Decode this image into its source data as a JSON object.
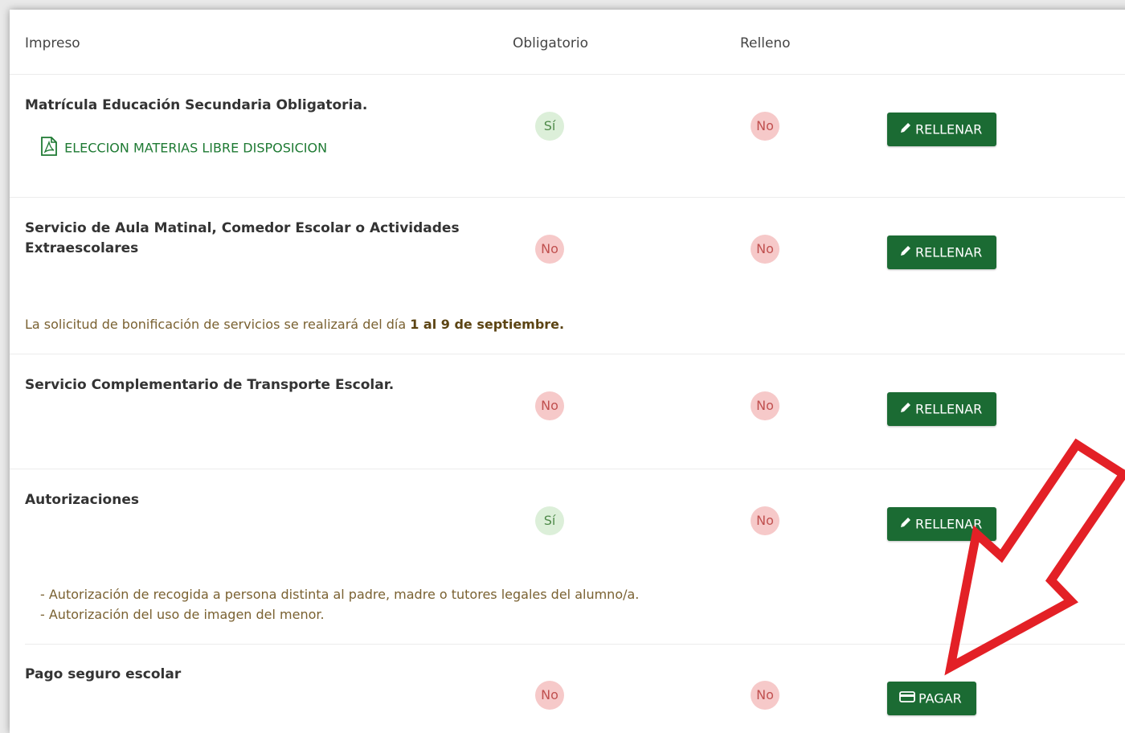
{
  "headers": {
    "impreso": "Impreso",
    "obligatorio": "Obligatorio",
    "relleno": "Relleno"
  },
  "rows": [
    {
      "title": "Matrícula Educación Secundaria Obligatoria.",
      "document_link": "ELECCION MATERIAS LIBRE DISPOSICION",
      "obligatorio": "Sí",
      "relleno": "No",
      "action": "RELLENAR",
      "action_icon": "pencil-icon"
    },
    {
      "title_line1": "Servicio de Aula Matinal, Comedor Escolar o Actividades",
      "title_line2": "Extraescolares",
      "obligatorio": "No",
      "relleno": "No",
      "action": "RELLENAR",
      "action_icon": "pencil-icon",
      "note_prefix": "La solicitud de bonificación de servicios se realizará del día ",
      "note_bold": "1 al 9 de septiembre."
    },
    {
      "title": "Servicio Complementario de Transporte Escolar.",
      "obligatorio": "No",
      "relleno": "No",
      "action": "RELLENAR",
      "action_icon": "pencil-icon"
    },
    {
      "title": "Autorizaciones",
      "obligatorio": "Sí",
      "relleno": "No",
      "action": "RELLENAR",
      "action_icon": "pencil-icon",
      "details": [
        "- Autorización de recogida a persona distinta al padre, madre o tutores legales del alumno/a.",
        "- Autorización del uso de imagen del menor."
      ]
    },
    {
      "title": "Pago seguro escolar",
      "obligatorio": "No",
      "relleno": "No",
      "action": "PAGAR",
      "action_icon": "credit-card-icon"
    }
  ],
  "colors": {
    "button_green": "#1b6b33",
    "badge_si_bg": "#dcefd9",
    "badge_no_bg": "#f6c9c9",
    "annotation_arrow": "#e32026"
  }
}
